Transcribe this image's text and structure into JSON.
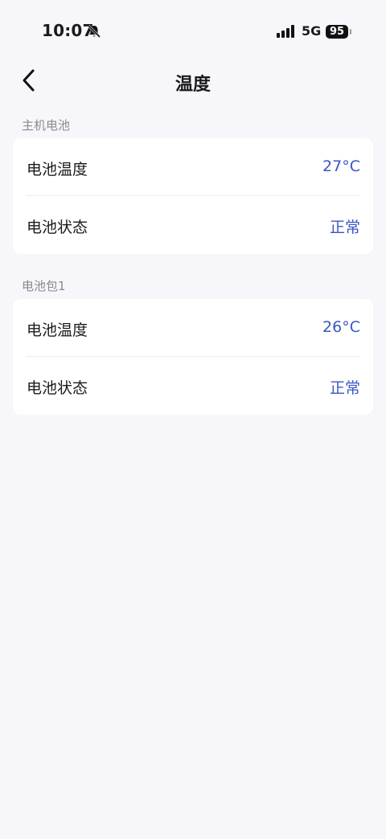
{
  "status_bar": {
    "time": "10:07",
    "network": "5G",
    "battery": "95"
  },
  "header": {
    "title": "温度"
  },
  "sections": [
    {
      "label": "主机电池",
      "rows": [
        {
          "label": "电池温度",
          "value": "27°C"
        },
        {
          "label": "电池状态",
          "value": "正常"
        }
      ]
    },
    {
      "label": "电池包1",
      "rows": [
        {
          "label": "电池温度",
          "value": "26°C"
        },
        {
          "label": "电池状态",
          "value": "正常"
        }
      ]
    }
  ],
  "colors": {
    "accent": "#3a56c4",
    "background": "#f6f6fb",
    "card": "#ffffff"
  }
}
